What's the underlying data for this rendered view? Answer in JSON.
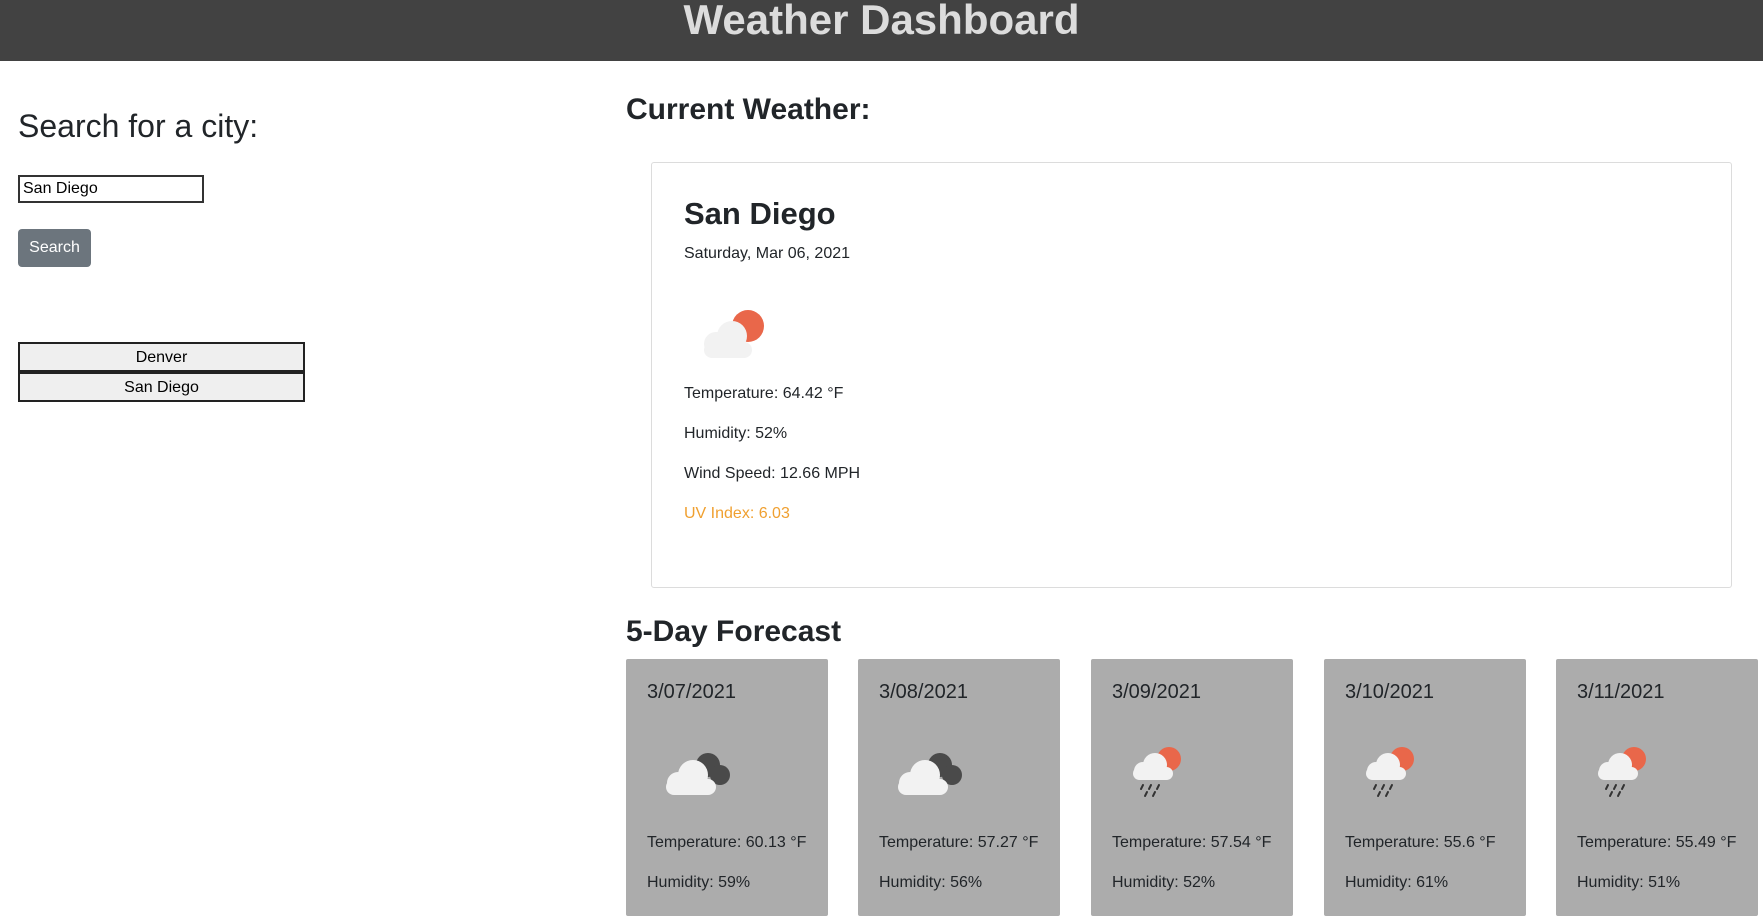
{
  "header": {
    "title": "Weather Dashboard"
  },
  "search": {
    "heading": "Search for a city:",
    "input_value": "San Diego",
    "button_label": "Search"
  },
  "history": [
    {
      "label": "Denver"
    },
    {
      "label": "San Diego"
    }
  ],
  "current": {
    "heading": "Current Weather:",
    "city": "San Diego",
    "date": "Saturday, Mar 06, 2021",
    "icon": "partly-cloudy-sun-icon",
    "temperature": "Temperature: 64.42 °F",
    "humidity": "Humidity: 52%",
    "wind": "Wind Speed: 12.66 MPH",
    "uv": "UV Index: 6.03",
    "uv_color": "#f0a030"
  },
  "forecast": {
    "heading": "5-Day Forecast",
    "days": [
      {
        "date": "3/07/2021",
        "icon": "overcast-clouds-icon",
        "temperature": "Temperature: 60.13 °F",
        "humidity": "Humidity: 59%"
      },
      {
        "date": "3/08/2021",
        "icon": "overcast-clouds-icon",
        "temperature": "Temperature: 57.27 °F",
        "humidity": "Humidity: 56%"
      },
      {
        "date": "3/09/2021",
        "icon": "rain-sun-icon",
        "temperature": "Temperature: 57.54 °F",
        "humidity": "Humidity: 52%"
      },
      {
        "date": "3/10/2021",
        "icon": "rain-sun-icon",
        "temperature": "Temperature: 55.6 °F",
        "humidity": "Humidity: 61%"
      },
      {
        "date": "3/11/2021",
        "icon": "rain-sun-icon",
        "temperature": "Temperature: 55.49 °F",
        "humidity": "Humidity: 51%"
      }
    ]
  },
  "colors": {
    "header_bg": "#424242",
    "header_text": "#dcdcdc",
    "button_bg": "#6c757d",
    "forecast_card_bg": "#acacac",
    "sun": "#e9674a"
  }
}
